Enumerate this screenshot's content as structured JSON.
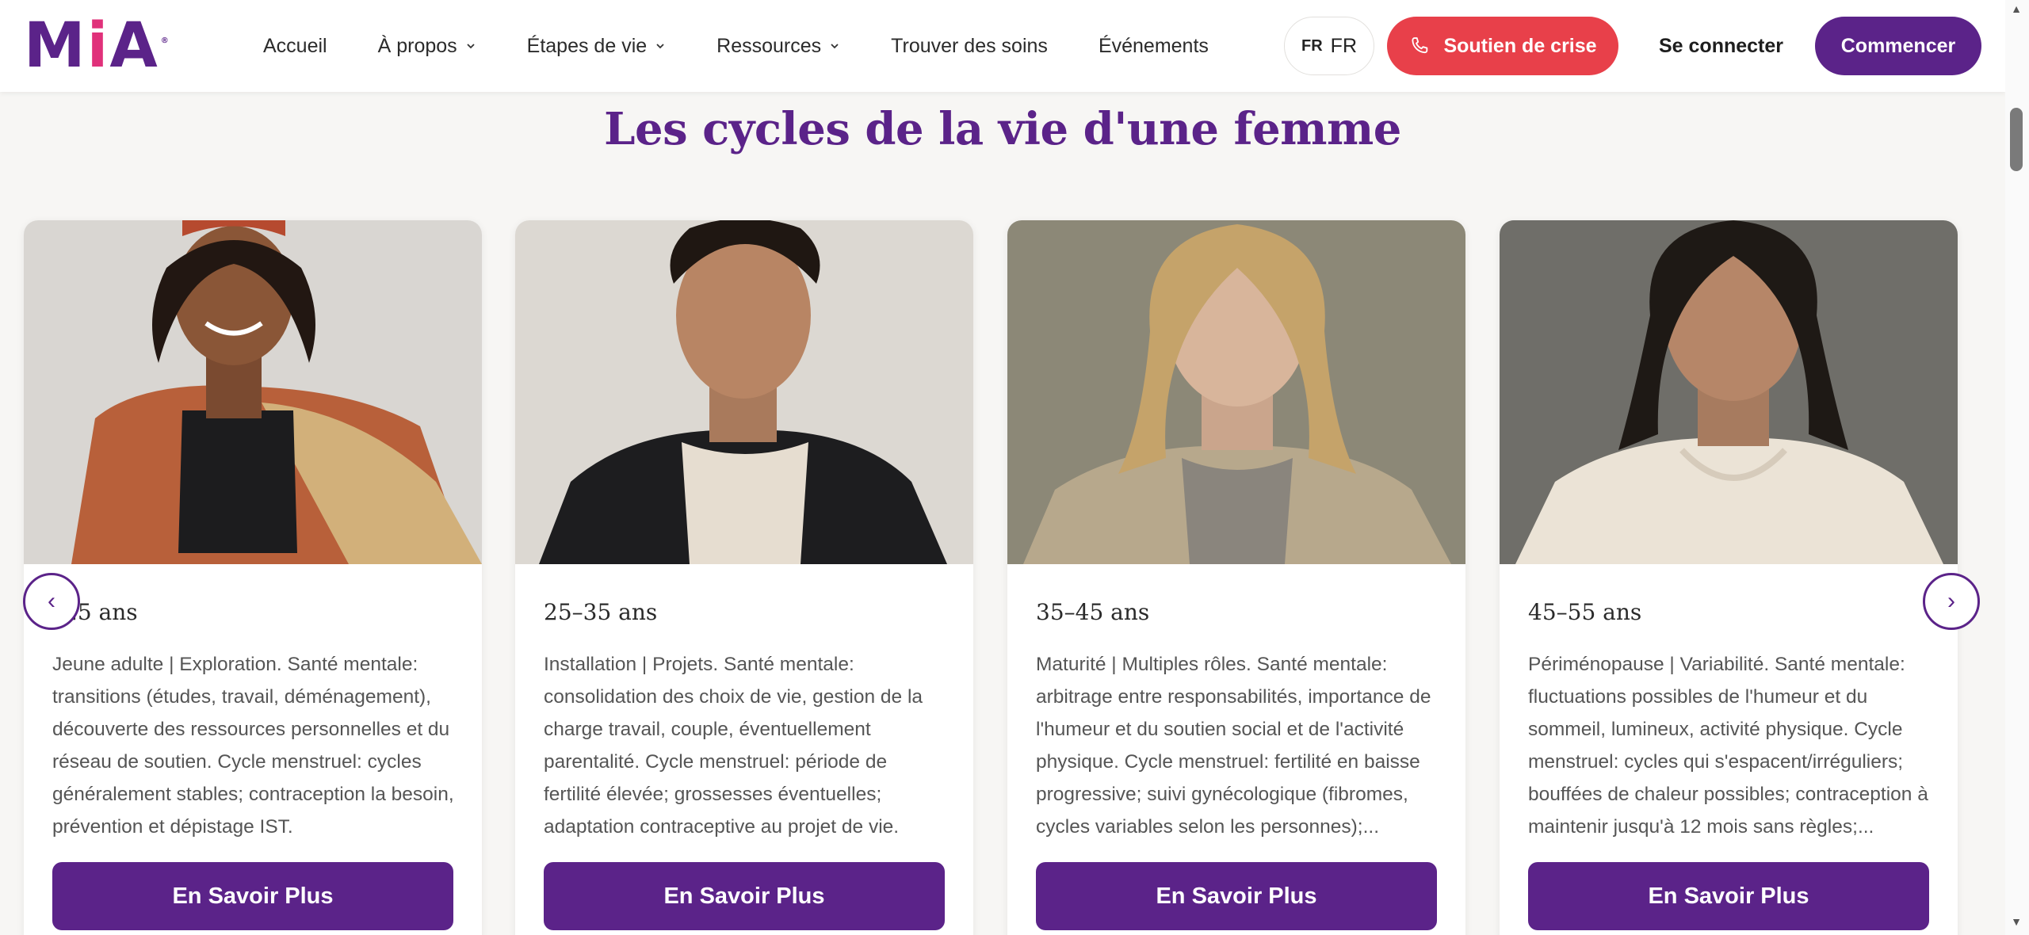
{
  "header": {
    "logo_text": "MiA",
    "logo_tm": "®",
    "nav": [
      {
        "label": "Accueil",
        "has_dropdown": false
      },
      {
        "label": "À propos",
        "has_dropdown": true
      },
      {
        "label": "Étapes de vie",
        "has_dropdown": true
      },
      {
        "label": "Ressources",
        "has_dropdown": true
      },
      {
        "label": "Trouver des soins",
        "has_dropdown": false
      },
      {
        "label": "Événements",
        "has_dropdown": false
      }
    ],
    "lang_flag": "FR",
    "lang_label": "FR",
    "crisis_label": "Soutien de crise",
    "login_label": "Se connecter",
    "start_label": "Commencer"
  },
  "section": {
    "title": "Les cycles de la vie d'une femme"
  },
  "cards": [
    {
      "age": "–25 ans",
      "desc": "Jeune adulte | Exploration. Santé mentale: transitions (études, travail, déménagement), découverte des ressources personnelles et du réseau de soutien. Cycle menstruel: cycles généralement stables; contraception la besoin, prévention et dépistage IST.",
      "button": "En Savoir Plus"
    },
    {
      "age": "25–35 ans",
      "desc": "Installation | Projets. Santé mentale: consolidation des choix de vie, gestion de la charge travail, couple, éventuellement parentalité. Cycle menstruel: période de fertilité élevée; grossesses éventuelles; adaptation contraceptive au projet de vie.",
      "button": "En Savoir Plus"
    },
    {
      "age": "35–45 ans",
      "desc": "Maturité | Multiples rôles. Santé mentale: arbitrage entre responsabilités, importance de l'humeur et du soutien social et de l'activité physique. Cycle menstruel: fertilité en baisse progressive; suivi gynécologique (fibromes, cycles variables selon les personnes);...",
      "button": "En Savoir Plus"
    },
    {
      "age": "45–55 ans",
      "desc": "Périménopause | Variabilité. Santé mentale: fluctuations possibles de l'humeur et du sommeil, lumineux, activité physique. Cycle menstruel: cycles qui s'espacent/irréguliers; bouffées de chaleur possibles; contraception à maintenir jusqu'à 12 mois sans règles;...",
      "button": "En Savoir Plus"
    }
  ],
  "carousel": {
    "prev_glyph": "‹",
    "next_glyph": "›"
  },
  "colors": {
    "brand_purple": "#5b2389",
    "crisis_red": "#e8404a",
    "logo_pink": "#e0317a"
  }
}
